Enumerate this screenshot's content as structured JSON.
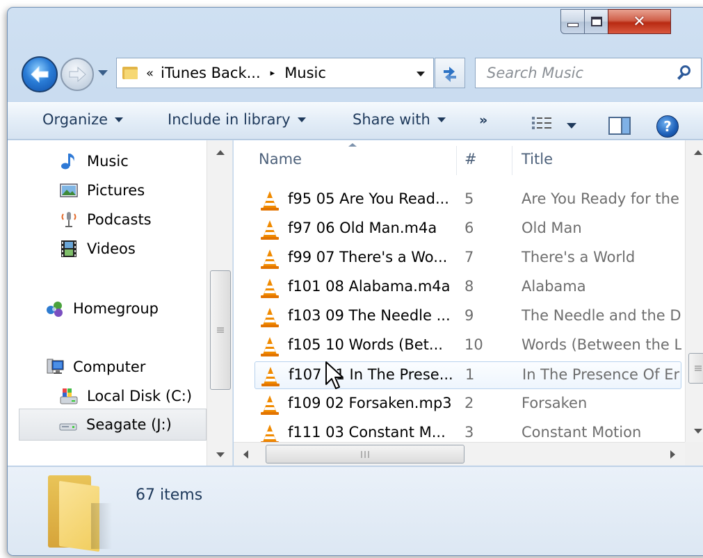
{
  "window": {
    "caption_buttons": {
      "minimize": "minimize",
      "maximize": "maximize",
      "close": "close"
    }
  },
  "address_bar": {
    "overflow": "«",
    "segments": [
      "iTunes Back...",
      "Music"
    ],
    "separator": "▸"
  },
  "search": {
    "placeholder": "Search Music"
  },
  "command_bar": {
    "organize": "Organize",
    "include_in_library": "Include in library",
    "share_with": "Share with",
    "more": "»",
    "help": "?"
  },
  "nav_pane": {
    "library_items": [
      "Music",
      "Pictures",
      "Podcasts",
      "Videos"
    ],
    "homegroup": "Homegroup",
    "computer": "Computer",
    "drives": [
      "Local Disk (C:)",
      "Seagate (J:)"
    ],
    "selected": "Seagate (J:)"
  },
  "file_list": {
    "columns": {
      "name": "Name",
      "number": "#",
      "title": "Title"
    },
    "sorted_by": "Name",
    "rows": [
      {
        "name": "f95 05 Are You Read...",
        "number": "5",
        "title": "Are You Ready for the"
      },
      {
        "name": "f97 06 Old Man.m4a",
        "number": "6",
        "title": "Old Man"
      },
      {
        "name": "f99 07 There's a Wo...",
        "number": "7",
        "title": "There's a World"
      },
      {
        "name": "f101 08 Alabama.m4a",
        "number": "8",
        "title": "Alabama"
      },
      {
        "name": "f103 09 The Needle ...",
        "number": "9",
        "title": "The Needle and the D"
      },
      {
        "name": "f105 10 Words (Bet...",
        "number": "10",
        "title": "Words (Between the L"
      },
      {
        "name": "f107 01 In The Prese...",
        "number": "1",
        "title": "In The Presence Of Er"
      },
      {
        "name": "f109 02 Forsaken.mp3",
        "number": "2",
        "title": "Forsaken"
      },
      {
        "name": "f111 03 Constant M...",
        "number": "3",
        "title": "Constant Motion"
      }
    ],
    "hovered_row": 6
  },
  "details_pane": {
    "item_count": "67 items"
  },
  "colors": {
    "chrome_blue": "#bcd2ea",
    "text_navy": "#1e395b",
    "close_red": "#c23a22",
    "vlc_orange": "#f08a00"
  }
}
